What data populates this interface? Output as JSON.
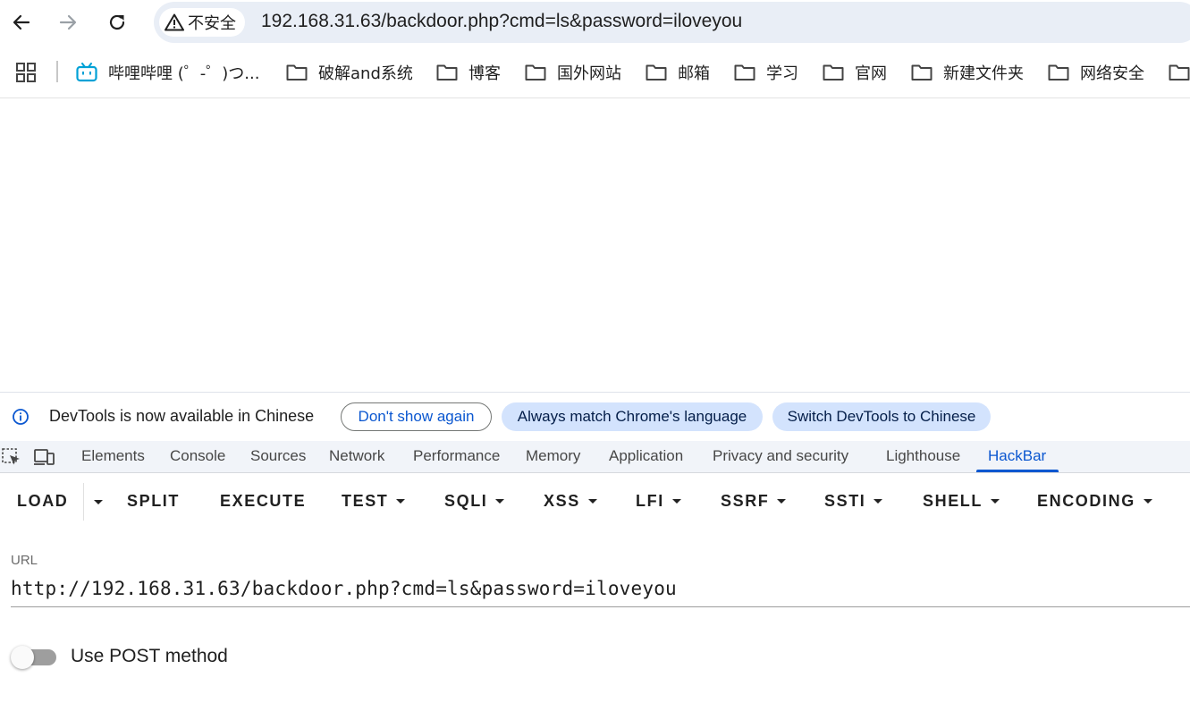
{
  "browser": {
    "security_label": "不安全",
    "url": "192.168.31.63/backdoor.php?cmd=ls&password=iloveyou"
  },
  "bookmarks": [
    {
      "label": "哔哩哔哩 (゜-゜)つ...",
      "icon": "bilibili-icon"
    },
    {
      "label": "破解and系统",
      "icon": "folder-icon"
    },
    {
      "label": "博客",
      "icon": "folder-icon"
    },
    {
      "label": "国外网站",
      "icon": "folder-icon"
    },
    {
      "label": "邮箱",
      "icon": "folder-icon"
    },
    {
      "label": "学习",
      "icon": "folder-icon"
    },
    {
      "label": "官网",
      "icon": "folder-icon"
    },
    {
      "label": "新建文件夹",
      "icon": "folder-icon"
    },
    {
      "label": "网络安全",
      "icon": "folder-icon"
    }
  ],
  "infobar": {
    "message": "DevTools is now available in Chinese",
    "dont_show": "Don't show again",
    "always_match": "Always match Chrome's language",
    "switch": "Switch DevTools to Chinese"
  },
  "devtools_tabs": [
    "Elements",
    "Console",
    "Sources",
    "Network",
    "Performance",
    "Memory",
    "Application",
    "Privacy and security",
    "Lighthouse",
    "HackBar"
  ],
  "active_tab": "HackBar",
  "hackbar": {
    "buttons": [
      "LOAD",
      "SPLIT",
      "EXECUTE",
      "TEST",
      "SQLI",
      "XSS",
      "LFI",
      "SSRF",
      "SSTI",
      "SHELL",
      "ENCODING"
    ],
    "url_label": "URL",
    "url_value": "http://192.168.31.63/backdoor.php?cmd=ls&password=iloveyou",
    "post_label": "Use POST method",
    "post_enabled": false
  },
  "colors": {
    "accent": "#0b57d0",
    "omnibox": "#e9eef6",
    "pill_fill": "#d3e3fd",
    "bilibili": "#00a1d6"
  }
}
